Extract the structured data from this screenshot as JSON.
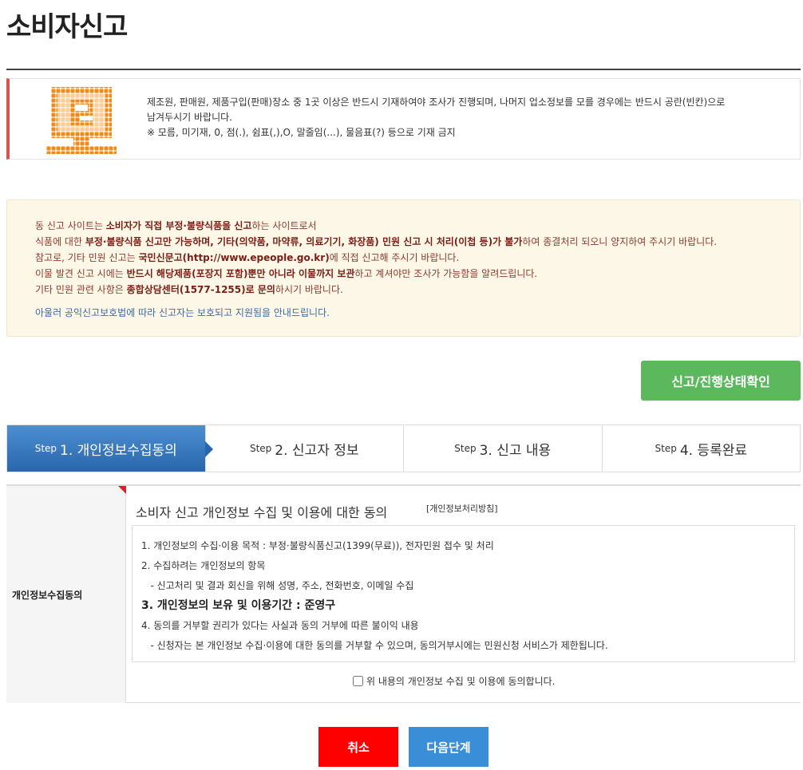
{
  "page": {
    "title": "소비자신고"
  },
  "notice": {
    "line1": "제조원, 판매원, 제품구입(판매)장소 중 1곳 이상은 반드시 기재하여야 조사가 진행되며, 나머지 업소정보를 모를 경우에는 반드시 공란(빈칸)으로",
    "line2": "남겨두시기 바랍니다.",
    "line3": "※ 모름, 미기재, 0, 점(.), 쉼표(,),O, 말줄임(...), 물음표(?) 등으로 기재 금지"
  },
  "info": {
    "l1_a": "동 신고 사이트는 ",
    "l1_b": "소비자가 직접 부정·불량식품을 신고",
    "l1_c": "하는 사이트로서",
    "l2_a": "식품에 대한 ",
    "l2_b": "부정·불량식품 신고만 가능하며, 기타(의약품, 마약류, 의료기기, 화장품) 민원 신고 시 처리(이첩 등)가 불가",
    "l2_c": "하여 종결처리 되오니 양지하여 주시기 바랍니다.",
    "l3_a": "참고로, 기타 민원 신고는 ",
    "l3_b": "국민신문고(http://www.epeople.go.kr)",
    "l3_c": "에 직접 신고해 주시기 바랍니다.",
    "l4_a": "이물 발견 신고 시에는 ",
    "l4_b": "반드시 해당제품(포장지 포함)뿐만 아니라 이물까지 보관",
    "l4_c": "하고 계셔야만 조사가 가능함을 알려드립니다.",
    "l5_a": "기타 민원 관련 사항은 ",
    "l5_b": "종합상담센터(1577-1255)로 문의",
    "l5_c": "하시기 바랍니다.",
    "l6": "아울러 공익신고보호법에 따라 신고자는 보호되고 지원됨을 안내드립니다."
  },
  "status_button": {
    "label": "신고/진행상태확인"
  },
  "steps": [
    {
      "pre": "Step",
      "label": "1. 개인정보수집동의"
    },
    {
      "pre": "Step",
      "label": "2. 신고자 정보"
    },
    {
      "pre": "Step",
      "label": "3. 신고 내용"
    },
    {
      "pre": "Step",
      "label": "4. 등록완료"
    }
  ],
  "consent": {
    "row_label": "개인정보수집동의",
    "heading": "소비자 신고 개인정보 수집 및 이용에 대한 동의",
    "policy_link": "[개인정보처리방침]",
    "items": [
      "1. 개인정보의 수집·이용 목적 : 부정·불량식품신고(1399(무료)), 전자민원 접수 및 처리",
      "2. 수집하려는 개인정보의 항목",
      "   - 신고처리 및 결과 회신을 위해 성명, 주소, 전화번호, 이메일 수집",
      "3. 개인정보의 보유 및 이용기간 : 준영구",
      "4. 동의를 거부할 권리가 있다는 사실과 동의 거부에 따른 불이익 내용",
      "   - 신청자는 본 개인정보 수집·이용에 대한 동의를 거부할 수 있으며, 동의거부시에는 민원신청 서비스가 제한됩니다."
    ],
    "agree_label": "위 내용의 개인정보 수집 및 이용에 동의합니다."
  },
  "buttons": {
    "cancel": "취소",
    "next": "다음단계"
  },
  "colors": {
    "accent_red": "#d9534f",
    "status_green": "#5cb85c",
    "step_active": "#2a66ad",
    "cancel_red": "#ff0000",
    "next_blue": "#3a8ed8"
  }
}
